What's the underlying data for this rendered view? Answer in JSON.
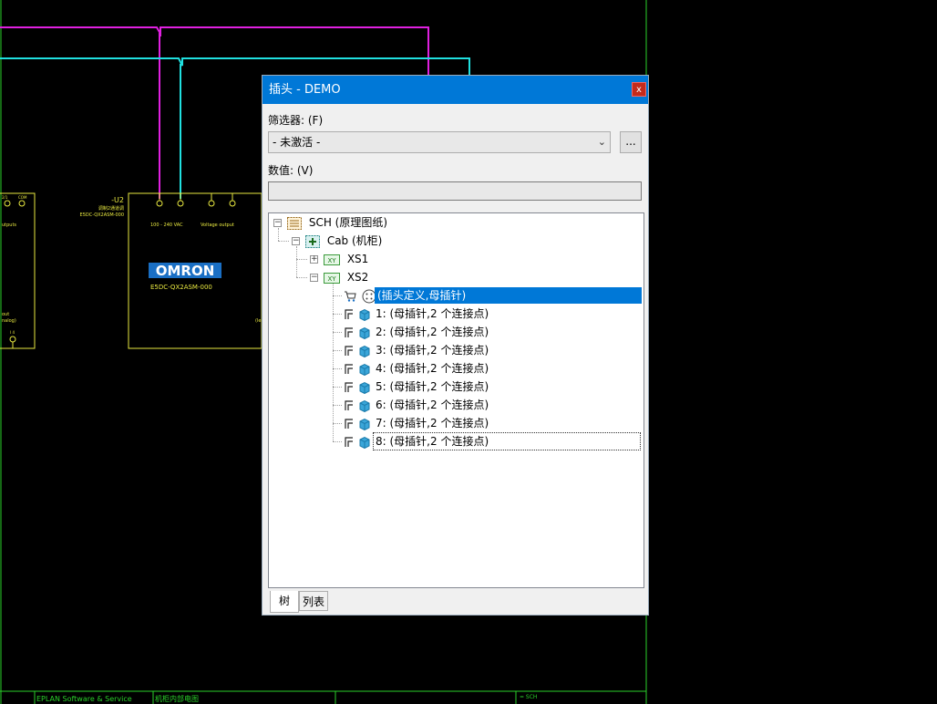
{
  "schematic": {
    "device_tag": "-U2",
    "device_desc": "调制2通道调",
    "device_part": "E5DC-QX2ASM-000",
    "brand": "OMRON",
    "part_label": "E5DC-QX2ASM-000",
    "pin_label_1": "100 - 240 VAC",
    "pin_label_2": "Voltage output",
    "left_pin_1": "2/1",
    "left_pin_2": "COM",
    "left_text_1": "utputs",
    "left_text_2": "out",
    "left_text_3": "nalog)",
    "left_text_4": "I 4",
    "right_frag": "(le",
    "footer_1": "EPLAN Software & Service",
    "footer_2": "机柜内部电图",
    "footer_3": "= SCH"
  },
  "dialog": {
    "title": "插头 - DEMO",
    "close_label": "x",
    "filter_label": "筛选器: (F)",
    "filter_value": "- 未激活 -",
    "more_label": "...",
    "value_label": "数值: (V)",
    "value_text": ""
  },
  "tree": {
    "root": "SCH (原理图纸)",
    "cab": "Cab (机柜)",
    "xs1": "XS1",
    "xs2": "XS2",
    "plug_def": "(插头定义,母插针)",
    "pins": [
      "1: (母插针,2 个连接点)",
      "2: (母插针,2 个连接点)",
      "3: (母插针,2 个连接点)",
      "4: (母插针,2 个连接点)",
      "5: (母插针,2 个连接点)",
      "6: (母插针,2 个连接点)",
      "7: (母插针,2 个连接点)",
      "8: (母插针,2 个连接点)"
    ]
  },
  "tabs": {
    "tree": "树",
    "list": "列表"
  },
  "colors": {
    "accent": "#0078d7",
    "selection": "#0078d7",
    "schematic_yellow": "#e8e840",
    "wire_magenta": "#e020e0",
    "wire_cyan": "#20e0e0",
    "frame_green": "#2ad02a"
  }
}
